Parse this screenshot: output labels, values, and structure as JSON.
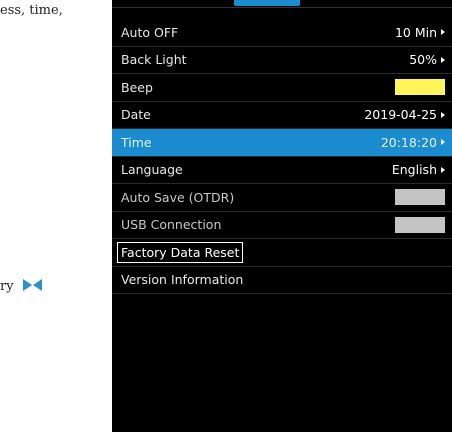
{
  "doc": {
    "line_1": "ess, time,",
    "line_2": "ry"
  },
  "colors": {
    "accent": "#1b8ccf",
    "toggle_on": "#fff45a",
    "toggle_off": "#c4c4c4",
    "background": "#000000"
  },
  "menu": {
    "items": [
      {
        "label": "Auto OFF",
        "value": "10 Min"
      },
      {
        "label": "Back Light",
        "value": "50%"
      },
      {
        "label": "Beep",
        "toggle": "on"
      },
      {
        "label": "Date",
        "value": "2019-04-25"
      },
      {
        "label": "Time",
        "value": "20:18:20",
        "selected": true
      },
      {
        "label": "Language",
        "value": "English"
      },
      {
        "label": "Auto Save (OTDR)",
        "toggle": "off"
      },
      {
        "label": "USB Connection",
        "toggle": "off"
      },
      {
        "label": "Factory Data Reset"
      },
      {
        "label": "Version Information"
      }
    ]
  }
}
